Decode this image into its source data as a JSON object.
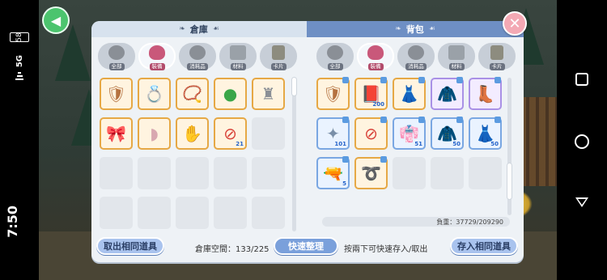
{
  "system": {
    "clock": "7:50",
    "network": "5G",
    "battery": "58"
  },
  "window": {
    "left_title": "倉庫",
    "right_title": "背包",
    "close_icon": "close-icon",
    "share_icon": "share-icon"
  },
  "tabs": {
    "left": [
      {
        "label": "全部",
        "icon": "helmet-icon",
        "active": false
      },
      {
        "label": "裝備",
        "icon": "hat-icon",
        "active": true
      },
      {
        "label": "消耗品",
        "icon": "potion-icon",
        "active": false
      },
      {
        "label": "材料",
        "icon": "box-icon",
        "active": false
      },
      {
        "label": "卡片",
        "icon": "card-icon",
        "active": false
      }
    ],
    "right": [
      {
        "label": "全部",
        "icon": "helmet-icon",
        "active": false
      },
      {
        "label": "裝備",
        "icon": "hat-icon",
        "active": true
      },
      {
        "label": "消耗品",
        "icon": "potion-icon",
        "active": false
      },
      {
        "label": "材料",
        "icon": "box-icon",
        "active": false
      },
      {
        "label": "卡片",
        "icon": "card-icon",
        "active": false
      }
    ]
  },
  "warehouse": {
    "items": [
      {
        "icon": "armor-piece-icon",
        "style": "orange"
      },
      {
        "icon": "ring-icon",
        "style": "orange"
      },
      {
        "icon": "necklace-icon",
        "style": "orange"
      },
      {
        "icon": "green-orb-icon",
        "style": "orange"
      },
      {
        "icon": "statue-icon",
        "style": "orange"
      },
      {
        "icon": "ribbon-headband-icon",
        "style": "orange"
      },
      {
        "icon": "horn-icon",
        "style": "orange"
      },
      {
        "icon": "gauntlet-icon",
        "style": "orange"
      },
      {
        "icon": "forbidden-item-icon",
        "style": "orange",
        "qty": "21"
      },
      {
        "icon": "",
        "style": "empty"
      },
      {
        "icon": "",
        "style": "empty"
      },
      {
        "icon": "",
        "style": "empty"
      },
      {
        "icon": "",
        "style": "empty"
      },
      {
        "icon": "",
        "style": "empty"
      },
      {
        "icon": "",
        "style": "empty"
      },
      {
        "icon": "",
        "style": "empty"
      },
      {
        "icon": "",
        "style": "empty"
      },
      {
        "icon": "",
        "style": "empty"
      },
      {
        "icon": "",
        "style": "empty"
      },
      {
        "icon": "",
        "style": "empty"
      }
    ]
  },
  "backpack": {
    "items": [
      {
        "icon": "shield-icon",
        "style": "orange"
      },
      {
        "icon": "spellbook-icon",
        "style": "orange",
        "qty": "200"
      },
      {
        "icon": "dress-icon",
        "style": "orange"
      },
      {
        "icon": "dark-jacket-icon",
        "style": "purple"
      },
      {
        "icon": "boots-icon",
        "style": "purple"
      },
      {
        "icon": "shuriken-icon",
        "style": "blue",
        "qty": "101"
      },
      {
        "icon": "forbidden-weapon-icon",
        "style": "orange"
      },
      {
        "icon": "robe-icon",
        "style": "blue",
        "qty": "51"
      },
      {
        "icon": "cloak-icon",
        "style": "blue",
        "qty": "50"
      },
      {
        "icon": "gown-icon",
        "style": "blue",
        "qty": "50"
      },
      {
        "icon": "gun-icon",
        "style": "blue",
        "qty": "5"
      },
      {
        "icon": "whip-icon",
        "style": "orange"
      },
      {
        "icon": "",
        "style": "empty"
      },
      {
        "icon": "",
        "style": "empty"
      },
      {
        "icon": "",
        "style": "empty"
      }
    ],
    "weight_label": "負重：37729/209290"
  },
  "footer": {
    "take_same": "取出相同道具",
    "storage_space": "倉庫空間：133/225",
    "quick_sort": "快速整理",
    "hint": "按兩下可快速存入/取出",
    "deposit_same": "存入相同道具"
  },
  "colors": {
    "accent": "#6e8fc4",
    "orange_frame": "#e6a845",
    "blue_frame": "#7aa7e2",
    "purple_frame": "#a991e6"
  }
}
